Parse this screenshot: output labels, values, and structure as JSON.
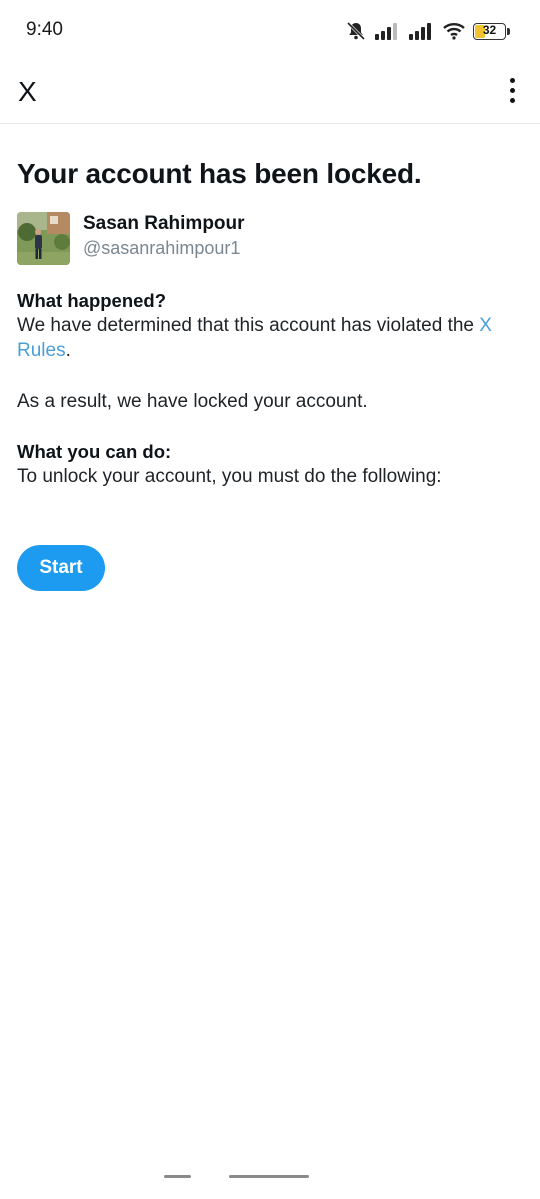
{
  "status_bar": {
    "time": "9:40",
    "battery_level": "32",
    "icons": [
      "bell-muted-icon",
      "signal-icon",
      "signal-icon",
      "wifi-icon",
      "battery-icon"
    ]
  },
  "app_bar": {
    "close_label": "X",
    "more_icon": "more-vertical-icon"
  },
  "main": {
    "title": "Your account has been locked.",
    "account": {
      "name": "Sasan Rahimpour",
      "handle": "@sasanrahimpour1"
    },
    "what_happened": {
      "heading": "What happened?",
      "text_before_link": "We have determined that this account has violated the ",
      "link_text": "X Rules",
      "text_after_link": "."
    },
    "result_text": "As a result, we have locked your account.",
    "what_you_can_do": {
      "heading": "What you can do:",
      "text": "To unlock your account, you must do the following:"
    },
    "start_label": "Start"
  },
  "colors": {
    "accent": "#1d9bf0",
    "link": "#4a9fd8",
    "text": "#0f1419",
    "muted": "#7a8791",
    "battery": "#f4c430"
  }
}
